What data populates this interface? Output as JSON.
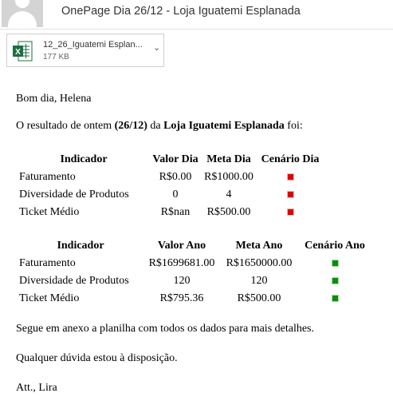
{
  "header": {
    "subject": "OnePage Dia 26/12 - Loja Iguatemi Esplanada"
  },
  "attachment": {
    "file_name": "12_26_Iguatemi Esplan...",
    "file_size": "177 KB",
    "icon": "excel-file-icon",
    "chevron": "⌄"
  },
  "email": {
    "greeting": "Bom dia, Helena",
    "intro_prefix": "O resultado de ontem ",
    "intro_date": "(26/12)",
    "intro_mid": " da ",
    "intro_store": "Loja Iguatemi Esplanada",
    "intro_suffix": " foi:",
    "attachment_note": "Segue em anexo a planilha com todos os dados para mais detalhes.",
    "help_note": "Qualquer dúvida estou à disposição.",
    "signoff": "Att., Lira"
  },
  "table_dia": {
    "headers": [
      "Indicador",
      "Valor Dia",
      "Meta Dia",
      "Cenário Dia"
    ],
    "rows": [
      {
        "indicador": "Faturamento",
        "valor": "R$0.00",
        "meta": "R$1000.00",
        "status": "red"
      },
      {
        "indicador": "Diversidade de Produtos",
        "valor": "0",
        "meta": "4",
        "status": "red"
      },
      {
        "indicador": "Ticket Médio",
        "valor": "R$nan",
        "meta": "R$500.00",
        "status": "red"
      }
    ]
  },
  "table_ano": {
    "headers": [
      "Indicador",
      "Valor Ano",
      "Meta Ano",
      "Cenário Ano"
    ],
    "rows": [
      {
        "indicador": "Faturamento",
        "valor": "R$1699681.00",
        "meta": "R$1650000.00",
        "status": "green"
      },
      {
        "indicador": "Diversidade de Produtos",
        "valor": "120",
        "meta": "120",
        "status": "green"
      },
      {
        "indicador": "Ticket Médio",
        "valor": "R$795.36",
        "meta": "R$500.00",
        "status": "green"
      }
    ]
  },
  "colors": {
    "status_red": "#e00000",
    "status_green": "#0a8f0a",
    "excel_green": "#1d6f42"
  }
}
